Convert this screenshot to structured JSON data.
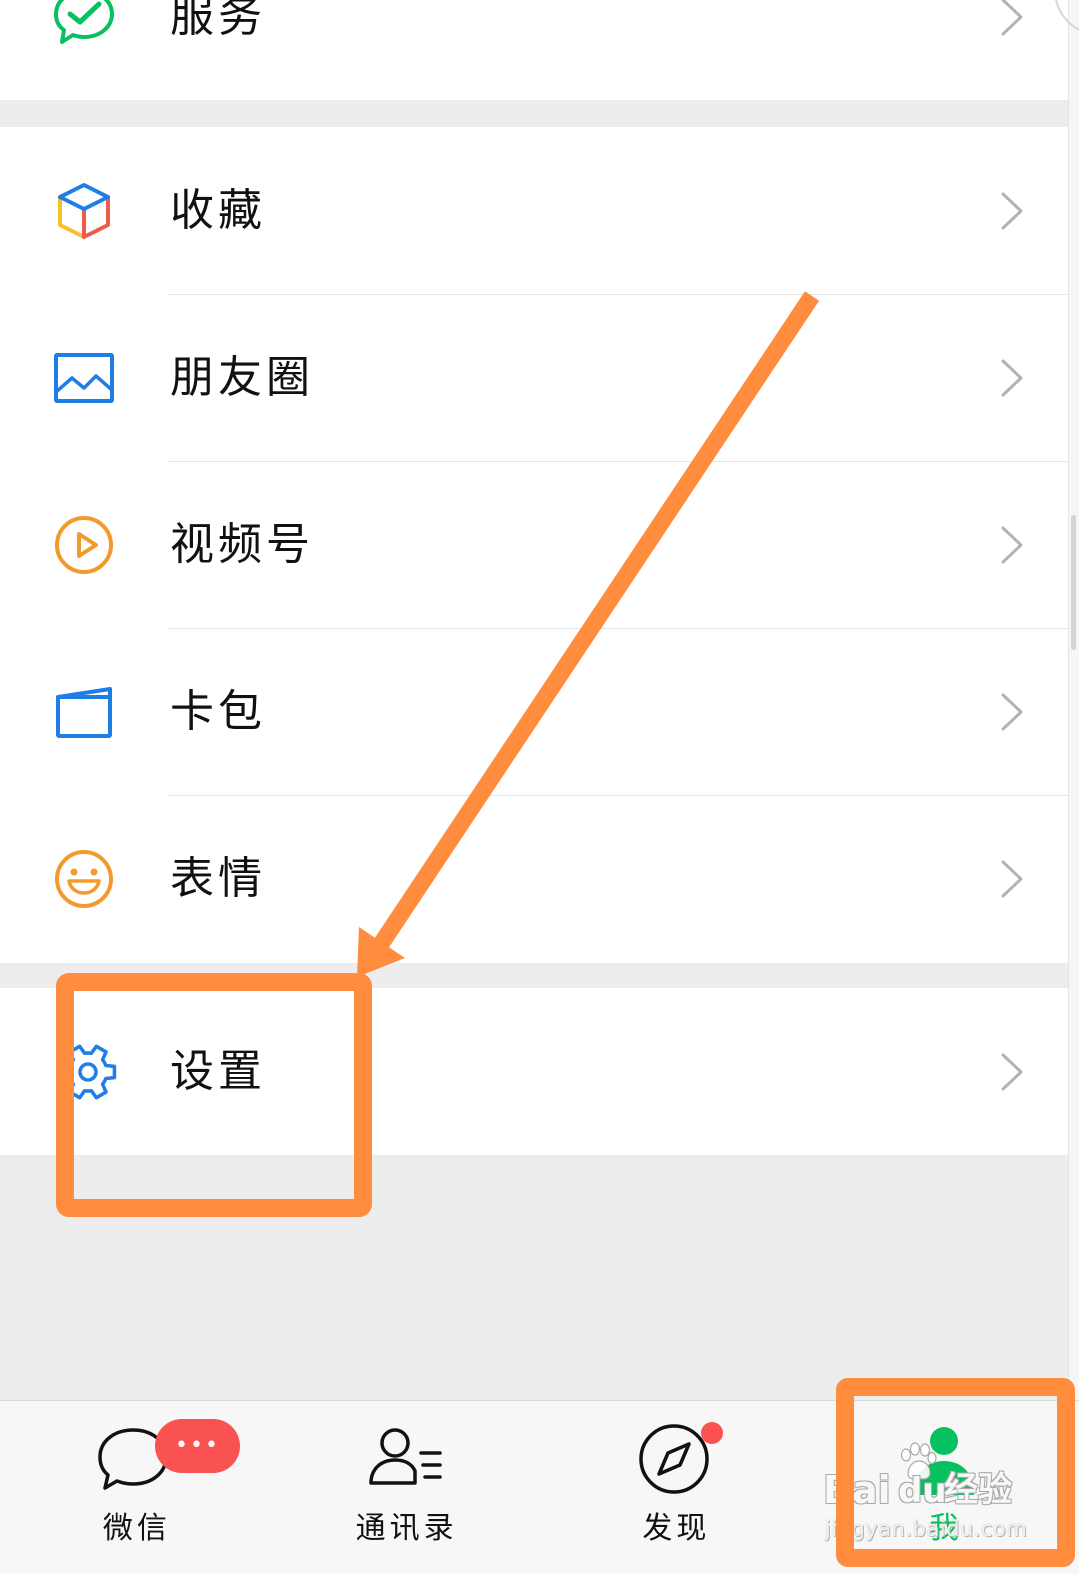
{
  "colors": {
    "background": "#ededed",
    "row": "#ffffff",
    "divider": "#e5e5e5",
    "chevron": "#b2b2b2",
    "tabbar": "#f7f7f7",
    "text": "#111111",
    "accent_green": "#07c160",
    "badge_red": "#fa5151",
    "annotation_orange": "#ff8d3d",
    "icon_blue": "#1f7de6",
    "icon_orange": "#f39a2d",
    "icon_yellow": "#f6c12c",
    "icon_red": "#f05a48"
  },
  "menu": {
    "service": {
      "label": "服务",
      "icon": "wechat-pay-icon"
    },
    "favorites": {
      "label": "收藏",
      "icon": "cube-icon"
    },
    "moments": {
      "label": "朋友圈",
      "icon": "picture-icon"
    },
    "channels": {
      "label": "视频号",
      "icon": "play-circle-icon"
    },
    "cards": {
      "label": "卡包",
      "icon": "card-wallet-icon"
    },
    "stickers": {
      "label": "表情",
      "icon": "smiley-icon"
    },
    "settings": {
      "label": "设置",
      "icon": "gear-icon"
    }
  },
  "tabbar": {
    "tabs": [
      {
        "label": "微信",
        "icon": "chat-bubble-icon",
        "badge": "•••"
      },
      {
        "label": "通讯录",
        "icon": "contacts-icon"
      },
      {
        "label": "发现",
        "icon": "compass-icon",
        "dot": true
      },
      {
        "label": "我",
        "icon": "person-icon",
        "selected": true
      }
    ]
  },
  "watermark": {
    "brand_left": "Bai",
    "brand_right": "du",
    "brand_cn": "经验",
    "url": "jingyan.baidu.com"
  }
}
